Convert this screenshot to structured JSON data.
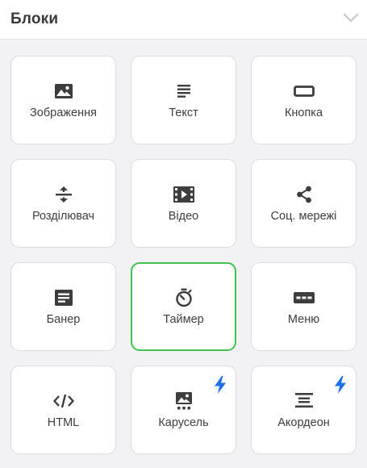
{
  "panel": {
    "title": "Блоки",
    "collapse_icon": "chevron-down-icon"
  },
  "colors": {
    "selected_border": "#3cc44f",
    "badge": "#1e6fe8",
    "icon": "#3d3d3d"
  },
  "blocks": [
    {
      "label": "Зображення",
      "icon": "image-icon",
      "selected": false,
      "pro": false
    },
    {
      "label": "Текст",
      "icon": "text-lines-icon",
      "selected": false,
      "pro": false
    },
    {
      "label": "Кнопка",
      "icon": "button-icon",
      "selected": false,
      "pro": false
    },
    {
      "label": "Розділювач",
      "icon": "divider-icon",
      "selected": false,
      "pro": false
    },
    {
      "label": "Відео",
      "icon": "video-icon",
      "selected": false,
      "pro": false
    },
    {
      "label": "Соц. мережі",
      "icon": "share-icon",
      "selected": false,
      "pro": false
    },
    {
      "label": "Банер",
      "icon": "banner-icon",
      "selected": false,
      "pro": false
    },
    {
      "label": "Таймер",
      "icon": "timer-icon",
      "selected": true,
      "pro": false
    },
    {
      "label": "Меню",
      "icon": "menu-icon",
      "selected": false,
      "pro": false
    },
    {
      "label": "HTML",
      "icon": "code-icon",
      "selected": false,
      "pro": false
    },
    {
      "label": "Карусель",
      "icon": "carousel-icon",
      "selected": false,
      "pro": true
    },
    {
      "label": "Акордеон",
      "icon": "accordion-icon",
      "selected": false,
      "pro": true
    }
  ]
}
